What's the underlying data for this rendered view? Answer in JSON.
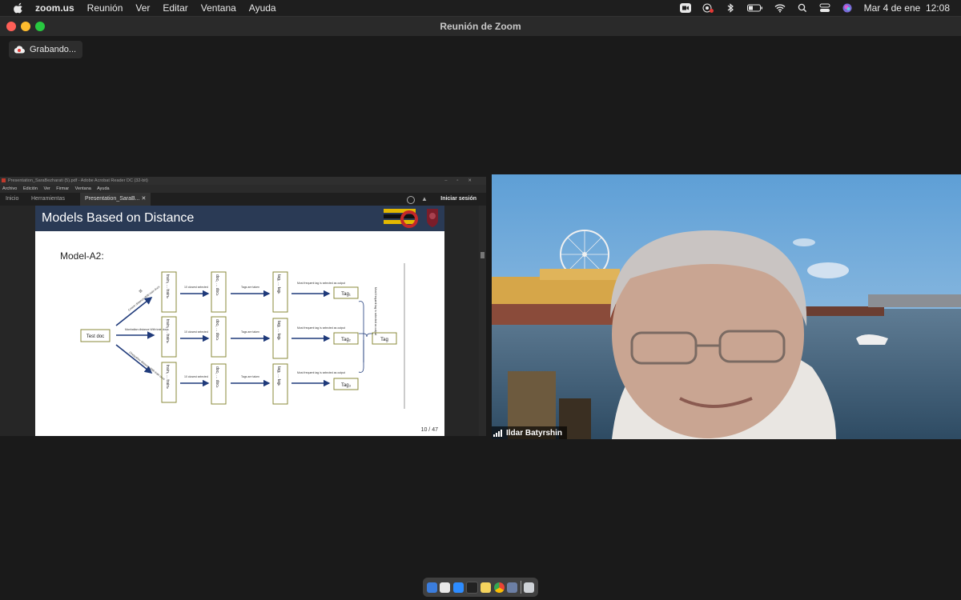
{
  "menubar": {
    "app_name": "zoom.us",
    "items": [
      "Reunión",
      "Ver",
      "Editar",
      "Ventana",
      "Ayuda"
    ],
    "datetime": "Mar 4 de ene  12:08"
  },
  "window": {
    "title": "Reunión de Zoom"
  },
  "recording": {
    "label": "Grabando..."
  },
  "acrobat": {
    "window_title": "Presentation_SaraBezharati (5).pdf - Adobe Acrobat Reader DC (32-bit)",
    "menu": [
      "Archivo",
      "Edición",
      "Ver",
      "Firmar",
      "Ventana",
      "Ayuda"
    ],
    "tabs": {
      "home": "Inicio",
      "tools": "Herramientas",
      "document": "Presentation_SaraB..."
    },
    "login": "Iniciar sesión"
  },
  "slide": {
    "title": "Models Based on Distance",
    "subtitle": "Model-A2:",
    "page": "10 / 47",
    "diagram": {
      "test_doc": "Test doc",
      "train_boxes": [
        "train₁ ... trainₙ",
        "train₁ ... trainₙ",
        "train₁ ... trainₙ"
      ],
      "doc_boxes": [
        "doc₁ ... docₖ",
        "doc₁ ... docₖ",
        "doc₁ ... docₖ"
      ],
      "tag_boxes": [
        "tag₁ ... tagₖ",
        "tag₁ ... tagₖ",
        "tag₁ ... tagₖ"
      ],
      "out_tags": [
        "Tag₁",
        "Tag₂",
        "Tag₃"
      ],
      "final_tag": "Tag",
      "edge_top": "Cosine distance With train docs",
      "edge_mid": "Manhattan distance With train docs",
      "edge_bot": "Chebyshev distance With train docs",
      "select_label": "10 closest selected",
      "taken_label": "Tags are taken",
      "most_label": "Most frequent tag is selected as output",
      "final_label": "Most frequent tag is selected as output"
    }
  },
  "video": {
    "participant": "Ildar Batyrshin"
  },
  "colors": {
    "slide_header": "#2a3a55",
    "arrow": "#1f3a7a",
    "box_border": "#8a8a3a"
  }
}
